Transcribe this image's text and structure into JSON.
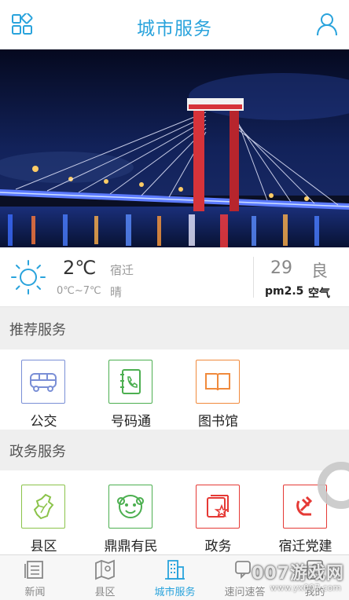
{
  "header": {
    "title": "城市服务"
  },
  "weather": {
    "temperature": "2℃",
    "range": "0℃~7℃",
    "city": "宿迁",
    "condition": "晴",
    "aqi_value": "29",
    "aqi_level": "良",
    "pm_label": "pm2.5",
    "air_label": "空气"
  },
  "recommended": {
    "title": "推荐服务",
    "items": [
      {
        "label": "公交",
        "icon": "bus-icon",
        "color": "#7a8fd6"
      },
      {
        "label": "号码通",
        "icon": "phonebook-icon",
        "color": "#4caf50"
      },
      {
        "label": "图书馆",
        "icon": "book-icon",
        "color": "#f08a3c"
      }
    ]
  },
  "government": {
    "title": "政务服务",
    "items": [
      {
        "label": "县区",
        "icon": "county-map-icon",
        "color": "#8bc34a"
      },
      {
        "label": "鼎鼎有民",
        "icon": "mascot-icon",
        "color": "#4caf50"
      },
      {
        "label": "政务",
        "icon": "gov-badge-icon",
        "color": "#e53935"
      },
      {
        "label": "宿迁党建",
        "icon": "party-emblem-icon",
        "color": "#e53935"
      }
    ]
  },
  "bottom_nav": {
    "items": [
      {
        "label": "新闻",
        "icon": "news-icon"
      },
      {
        "label": "县区",
        "icon": "map-icon"
      },
      {
        "label": "城市服务",
        "icon": "building-icon",
        "active": true
      },
      {
        "label": "速问速答",
        "icon": "qa-icon"
      },
      {
        "label": "我的",
        "icon": "profile-icon"
      }
    ]
  },
  "watermark": {
    "text": "007游戏网",
    "url": "www.yx007.com"
  },
  "colors": {
    "accent": "#29a3dc",
    "section_bg": "#efefef"
  }
}
